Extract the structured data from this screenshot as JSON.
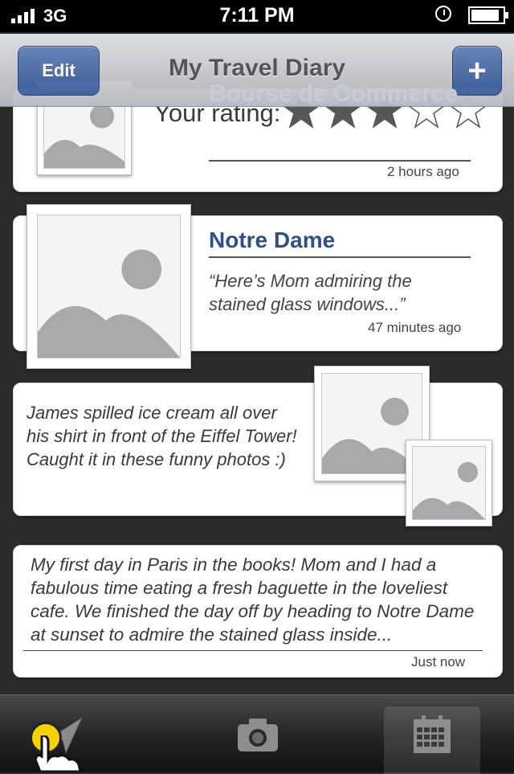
{
  "status": {
    "carrier": "3G",
    "time": "7:11 PM",
    "battery_level": 0.9
  },
  "header": {
    "title": "My Travel Diary",
    "edit_label": "Edit",
    "add_label": "+"
  },
  "entries": [
    {
      "ghost_title": "Bourse de Commerce",
      "rating_label": "Your rating:",
      "rating": 3,
      "rating_max": 5,
      "time": "2 hours ago"
    },
    {
      "title": "Notre Dame",
      "quote": "“Here’s Mom admiring the stained glass windows...”",
      "time": "47 minutes ago"
    },
    {
      "text": "James spilled ice cream all over his shirt in front of the Eiffel Tower! Caught it in these funny photos :)"
    },
    {
      "text": "My first day in Paris in the books! Mom and I had a fabulous time eating a fresh baguette in the loveliest cafe. We finished the day off by heading to Notre Dame at sunset to admire the stained glass inside...",
      "time": "Just now"
    }
  ],
  "tabbar": {
    "tabs": [
      {
        "icon": "location-arrow-icon",
        "active": false
      },
      {
        "icon": "camera-icon",
        "active": false
      },
      {
        "icon": "calendar-icon",
        "active": true
      }
    ]
  },
  "colors": {
    "accent": "#3c5e9b",
    "title_blue": "#2f4f86",
    "tap_indicator": "#f6d100"
  }
}
